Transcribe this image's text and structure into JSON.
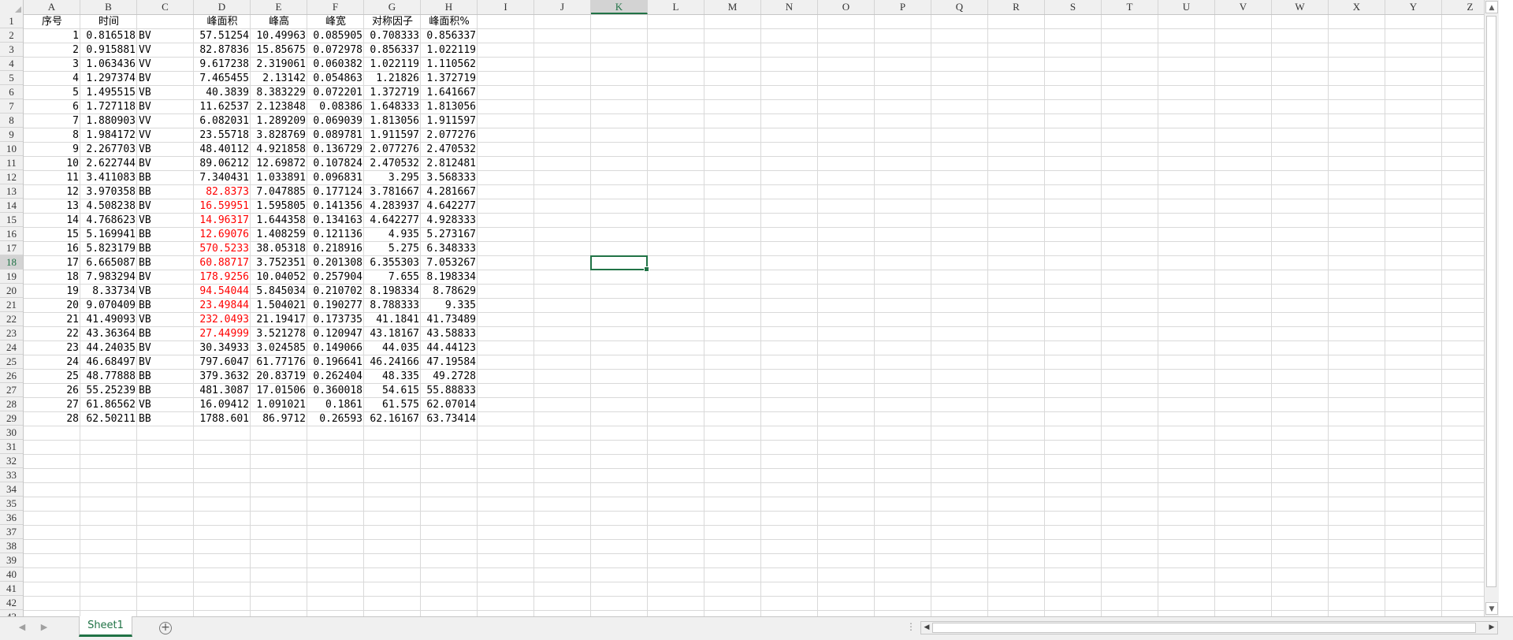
{
  "columns": [
    "A",
    "B",
    "C",
    "D",
    "E",
    "F",
    "G",
    "H",
    "I",
    "J",
    "K",
    "L",
    "M",
    "N",
    "O",
    "P",
    "Q",
    "R",
    "S",
    "T",
    "U",
    "V",
    "W",
    "X",
    "Y",
    "Z"
  ],
  "selected_column": "K",
  "selected_row": 18,
  "row_count": 43,
  "header_row": [
    "序号",
    "时间",
    "",
    "峰面积",
    "峰高",
    "峰宽",
    "对称因子",
    "峰面积%"
  ],
  "rows": [
    [
      "1",
      "0.816518",
      "BV",
      "57.51254",
      "10.49963",
      "0.085905",
      "0.708333",
      "0.856337"
    ],
    [
      "2",
      "0.915881",
      "VV",
      "82.87836",
      "15.85675",
      "0.072978",
      "0.856337",
      "1.022119"
    ],
    [
      "3",
      "1.063436",
      "VV",
      "9.617238",
      "2.319061",
      "0.060382",
      "1.022119",
      "1.110562"
    ],
    [
      "4",
      "1.297374",
      "BV",
      "7.465455",
      "2.13142",
      "0.054863",
      "1.21826",
      "1.372719"
    ],
    [
      "5",
      "1.495515",
      "VB",
      "40.3839",
      "8.383229",
      "0.072201",
      "1.372719",
      "1.641667"
    ],
    [
      "6",
      "1.727118",
      "BV",
      "11.62537",
      "2.123848",
      "0.08386",
      "1.648333",
      "1.813056"
    ],
    [
      "7",
      "1.880903",
      "VV",
      "6.082031",
      "1.289209",
      "0.069039",
      "1.813056",
      "1.911597"
    ],
    [
      "8",
      "1.984172",
      "VV",
      "23.55718",
      "3.828769",
      "0.089781",
      "1.911597",
      "2.077276"
    ],
    [
      "9",
      "2.267703",
      "VB",
      "48.40112",
      "4.921858",
      "0.136729",
      "2.077276",
      "2.470532"
    ],
    [
      "10",
      "2.622744",
      "BV",
      "89.06212",
      "12.69872",
      "0.107824",
      "2.470532",
      "2.812481"
    ],
    [
      "11",
      "3.411083",
      "BB",
      "7.340431",
      "1.033891",
      "0.096831",
      "3.295",
      "3.568333"
    ],
    [
      "12",
      "3.970358",
      "BB",
      "82.8373",
      "7.047885",
      "0.177124",
      "3.781667",
      "4.281667"
    ],
    [
      "13",
      "4.508238",
      "BV",
      "16.59951",
      "1.595805",
      "0.141356",
      "4.283937",
      "4.642277"
    ],
    [
      "14",
      "4.768623",
      "VB",
      "14.96317",
      "1.644358",
      "0.134163",
      "4.642277",
      "4.928333"
    ],
    [
      "15",
      "5.169941",
      "BB",
      "12.69076",
      "1.408259",
      "0.121136",
      "4.935",
      "5.273167"
    ],
    [
      "16",
      "5.823179",
      "BB",
      "570.5233",
      "38.05318",
      "0.218916",
      "5.275",
      "6.348333"
    ],
    [
      "17",
      "6.665087",
      "BB",
      "60.88717",
      "3.752351",
      "0.201308",
      "6.355303",
      "7.053267"
    ],
    [
      "18",
      "7.983294",
      "BV",
      "178.9256",
      "10.04052",
      "0.257904",
      "7.655",
      "8.198334"
    ],
    [
      "19",
      "8.33734",
      "VB",
      "94.54044",
      "5.845034",
      "0.210702",
      "8.198334",
      "8.78629"
    ],
    [
      "20",
      "9.070409",
      "BB",
      "23.49844",
      "1.504021",
      "0.190277",
      "8.788333",
      "9.335"
    ],
    [
      "21",
      "41.49093",
      "VB",
      "232.0493",
      "21.19417",
      "0.173735",
      "41.1841",
      "41.73489"
    ],
    [
      "22",
      "43.36364",
      "BB",
      "27.44999",
      "3.521278",
      "0.120947",
      "43.18167",
      "43.58833"
    ],
    [
      "23",
      "44.24035",
      "BV",
      "30.34933",
      "3.024585",
      "0.149066",
      "44.035",
      "44.44123"
    ],
    [
      "24",
      "46.68497",
      "BV",
      "797.6047",
      "61.77176",
      "0.196641",
      "46.24166",
      "47.19584"
    ],
    [
      "25",
      "48.77888",
      "BB",
      "379.3632",
      "20.83719",
      "0.262404",
      "48.335",
      "49.2728"
    ],
    [
      "26",
      "55.25239",
      "BB",
      "481.3087",
      "17.01506",
      "0.360018",
      "54.615",
      "55.88833"
    ],
    [
      "27",
      "61.86562",
      "VB",
      "16.09412",
      "1.091021",
      "0.1861",
      "61.575",
      "62.07014"
    ],
    [
      "28",
      "62.50211",
      "BB",
      "1788.601",
      "86.9712",
      "0.26593",
      "62.16167",
      "63.73414"
    ]
  ],
  "red_d_rows": [
    12,
    13,
    14,
    15,
    16,
    17,
    18,
    19,
    20,
    21,
    22
  ],
  "sheet_tab": "Sheet1",
  "add_sheet_symbol": "+",
  "colors": {
    "accent": "#217346",
    "red": "#ff0000",
    "grid": "#d9d9d9"
  }
}
